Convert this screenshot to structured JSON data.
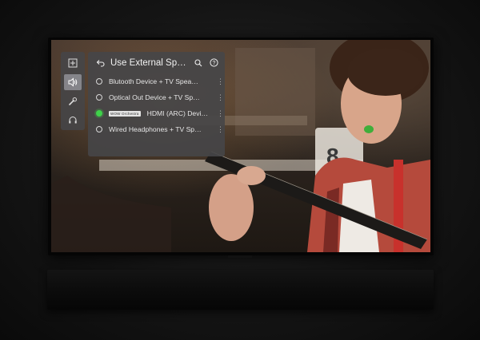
{
  "sidebar": {
    "items": [
      {
        "icon": "picture-settings-icon",
        "active": false
      },
      {
        "icon": "speaker-icon",
        "active": true
      },
      {
        "icon": "wrench-icon",
        "active": false
      },
      {
        "icon": "headset-icon",
        "active": false
      }
    ]
  },
  "panel": {
    "title": "Use External Speak…",
    "back_icon": "back-arrow-icon",
    "search_icon": "search-icon",
    "help_icon": "help-icon",
    "options": [
      {
        "label": "Blutooth Device + TV Spea…",
        "selected": false,
        "badge": ""
      },
      {
        "label": "Optical Out Device + TV Sp…",
        "selected": false,
        "badge": ""
      },
      {
        "label": "HDMI (ARC) Devi…",
        "selected": true,
        "badge": "WOW Orchestra"
      },
      {
        "label": "Wired Headphones + TV Sp…",
        "selected": false,
        "badge": ""
      }
    ]
  },
  "colors": {
    "selected_radio": "#3fd24a",
    "panel_bg": "#464648"
  }
}
